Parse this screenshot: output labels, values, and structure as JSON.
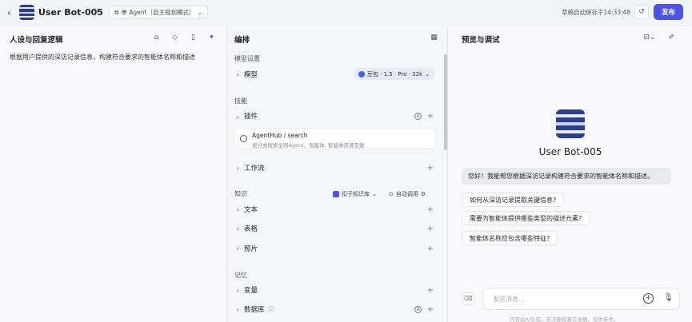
{
  "header": {
    "bot_name": "User Bot-005",
    "mode_label": "单 Agent（自主规划模式）",
    "autosave": "草稿自动保存于14:33:48",
    "publish": "发布"
  },
  "left": {
    "title": "人设与回复逻辑",
    "prompt": "根据用户提供的深访记录信息，构建符合要求的智能体名称和描述"
  },
  "middle": {
    "title": "编排",
    "model_section": "模型设置",
    "model_label": "模型",
    "model_value": "豆包 · 1.5 · Pro · 32k",
    "skills_section": "技能",
    "plugins_label": "插件",
    "plugin_title": "AgentHub / search",
    "plugin_desc": "按分类搜索全网Agent、智能体, 智能体资源互换",
    "workflow_label": "工作流",
    "knowledge_section": "知识",
    "kb_source": "扣子知识库",
    "kb_mode": "自动调用",
    "text_label": "文本",
    "table_label": "表格",
    "photo_label": "照片",
    "memory_section": "记忆",
    "variable_label": "变量",
    "database_label": "数据库"
  },
  "right": {
    "title": "预览与调试",
    "bot_name": "User Bot-005",
    "greeting": "您好！我能帮您根据深访记录构建符合要求的智能体名称和描述。",
    "suggestions": [
      "如何从深访记录提取关键信息?",
      "需要为智能体提供哪些类型的描述元素?",
      "智能体名称应包含哪些特征?"
    ],
    "input_placeholder": "发送消息...",
    "disclaimer": "内容由AI生成，无法确保真实准确，仅供参考。"
  }
}
